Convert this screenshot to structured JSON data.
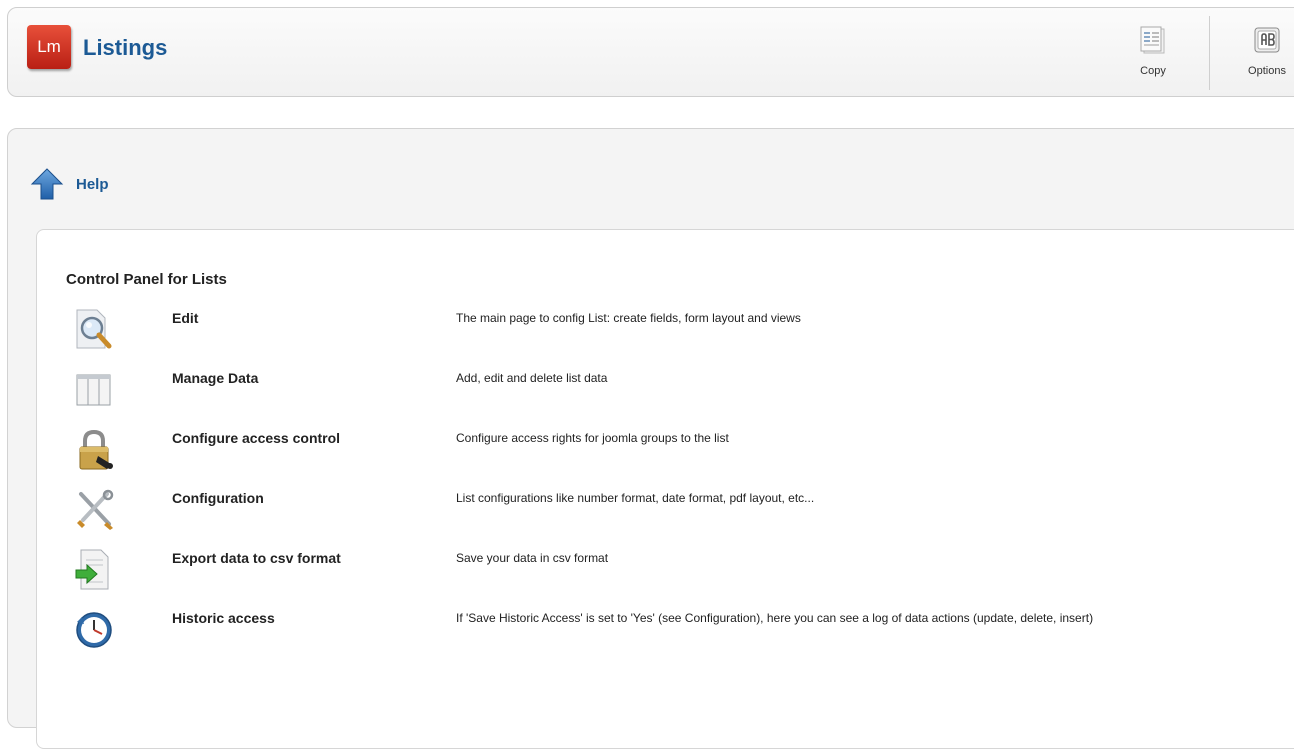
{
  "header": {
    "logo_text": "Lm",
    "title": "Listings",
    "toolbar": {
      "copy_label": "Copy",
      "options_label": "Options"
    }
  },
  "help": {
    "label": "Help"
  },
  "control_panel": {
    "title": "Control Panel for Lists",
    "items": [
      {
        "icon": "magnifier-document-icon",
        "name": "Edit",
        "description": "The main page to config List: create fields, form layout and views"
      },
      {
        "icon": "columns-table-icon",
        "name": "Manage Data",
        "description": "Add, edit and delete list data"
      },
      {
        "icon": "padlock-icon",
        "name": "Configure access control",
        "description": "Configure access rights for joomla groups to the list"
      },
      {
        "icon": "tools-icon",
        "name": "Configuration",
        "description": "List configurations like number format, date format, pdf layout, etc..."
      },
      {
        "icon": "export-document-icon",
        "name": "Export data to csv format",
        "description": "Save your data in csv format"
      },
      {
        "icon": "clock-history-icon",
        "name": "Historic access",
        "description": "If 'Save Historic Access' is set to 'Yes' (see Configuration), here you can see a log of data actions (update, delete, insert)"
      }
    ]
  },
  "colors": {
    "title_blue": "#1c5a95",
    "logo_red": "#c9281b"
  }
}
